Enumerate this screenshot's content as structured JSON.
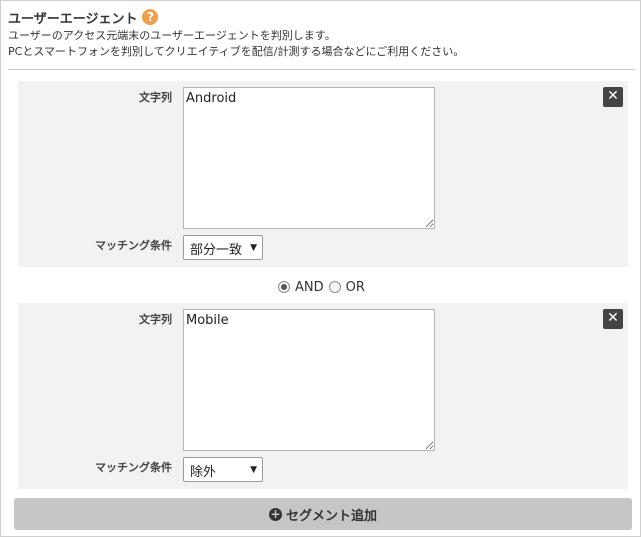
{
  "header": {
    "title": "ユーザーエージェント",
    "help_glyph": "?",
    "desc_line1": "ユーザーのアクセス元端末のユーザーエージェントを判別します。",
    "desc_line2": "PCとスマートフォンを判別してクリエイティブを配信/計測する場合などにご利用ください。"
  },
  "segments": [
    {
      "string_label": "文字列",
      "string_value": "Android",
      "match_label": "マッチング条件",
      "match_value": "部分一致",
      "remove_glyph": "✕"
    },
    {
      "string_label": "文字列",
      "string_value": "Mobile",
      "match_label": "マッチング条件",
      "match_value": "除外",
      "remove_glyph": "✕"
    }
  ],
  "operator": {
    "and_label": "AND",
    "or_label": "OR",
    "selected": "AND"
  },
  "add_button": {
    "label": "セグメント追加",
    "icon_glyph": "+"
  },
  "select_arrow": "▼",
  "colors": {
    "help_icon": "#f0a04b",
    "panel_bg": "#f2f2f2",
    "close_bg": "#444444",
    "add_button_bg": "#c6c6c6"
  }
}
